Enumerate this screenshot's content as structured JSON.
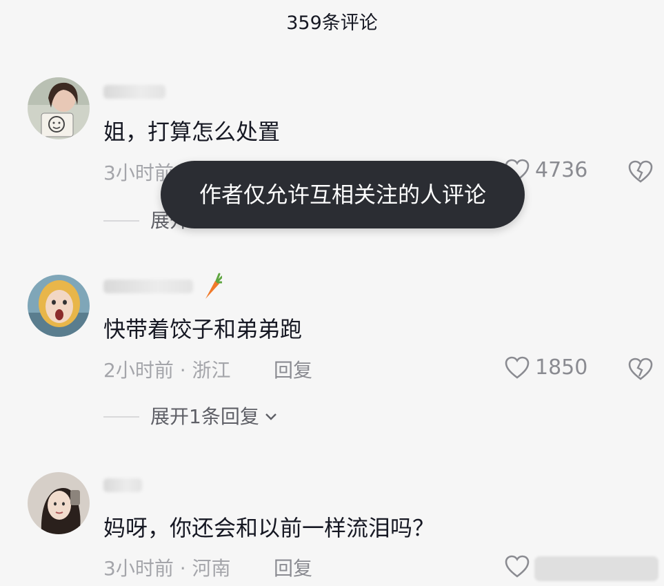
{
  "header": {
    "title": "359条评论"
  },
  "toast": {
    "message": "作者仅允许互相关注的人评论"
  },
  "comments": [
    {
      "text": "姐，打算怎么处置",
      "time": "3小时前",
      "location": "",
      "likes": "4736",
      "expand_label": "展开",
      "reply_label": "回复"
    },
    {
      "text": "快带着饺子和弟弟跑",
      "time": "2小时前",
      "location": "浙江",
      "meta": "2小时前 · 浙江",
      "likes": "1850",
      "expand_label": "展开1条回复",
      "reply_label": "回复"
    },
    {
      "text": "妈呀，你还会和以前一样流泪吗？",
      "time": "3小时前",
      "location": "河南",
      "meta": "3小时前 · 河南",
      "likes": "",
      "reply_label": "回复"
    }
  ],
  "colors": {
    "background": "#f6f6f6",
    "text_primary": "#161823",
    "text_secondary": "#a4a5aa",
    "toast_bg": "#2b2d33"
  }
}
